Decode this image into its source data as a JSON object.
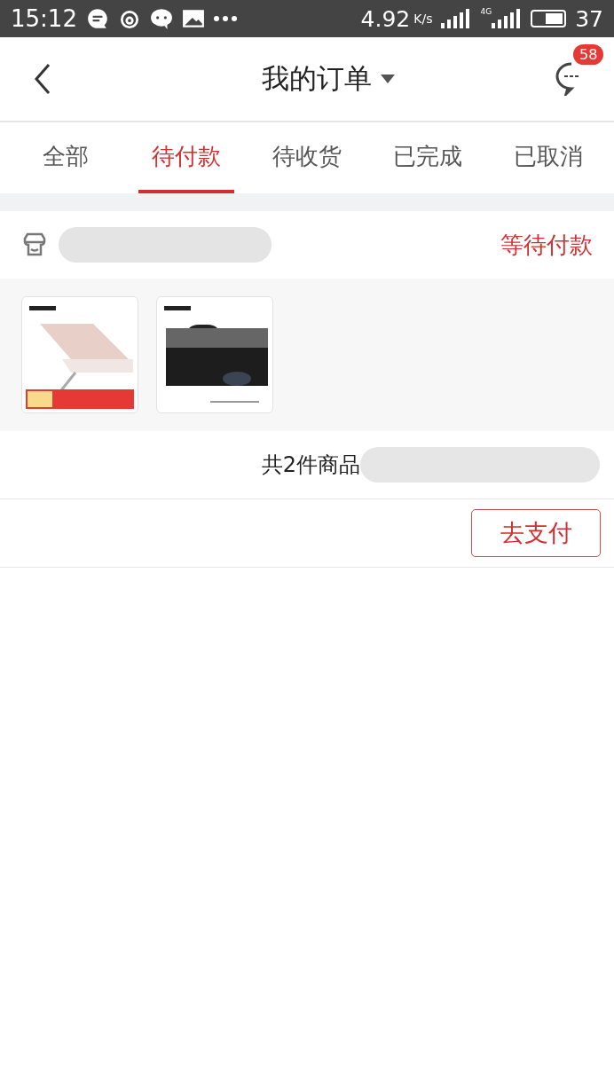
{
  "status_bar": {
    "time": "15:12",
    "speed": "4.92",
    "speed_unit": "K/s",
    "network": "4G",
    "battery": "37"
  },
  "header": {
    "title": "我的订单",
    "badge": "58"
  },
  "tabs": [
    {
      "label": "全部",
      "selected": false
    },
    {
      "label": "待付款",
      "selected": true
    },
    {
      "label": "待收货",
      "selected": false
    },
    {
      "label": "已完成",
      "selected": false
    },
    {
      "label": "已取消",
      "selected": false
    }
  ],
  "order": {
    "status": "等待付款",
    "summary": "共2件商品",
    "button": "去支付"
  }
}
